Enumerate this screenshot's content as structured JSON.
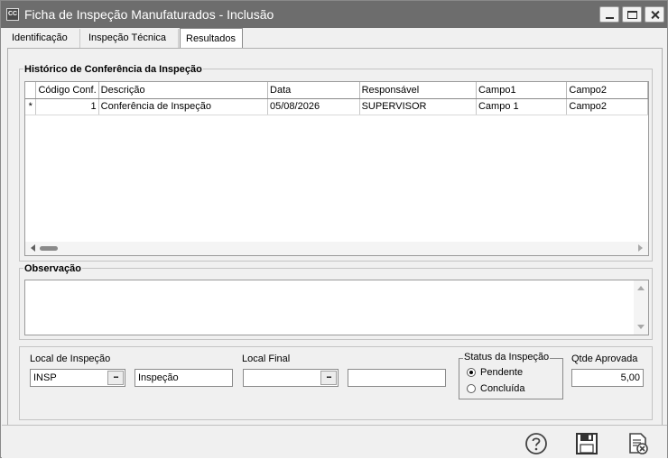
{
  "window": {
    "app_icon_text": "CC",
    "title": "Ficha de Inspeção Manufaturados - Inclusão"
  },
  "tabs": [
    {
      "label": "Identificação",
      "active": false
    },
    {
      "label": "Inspeção Técnica",
      "active": false
    },
    {
      "label": "Resultados",
      "active": true
    }
  ],
  "historico": {
    "title": "Histórico de Conferência da Inspeção",
    "columns": [
      "Código Conf.",
      "Descrição",
      "Data",
      "Responsável",
      "Campo1",
      "Campo2"
    ],
    "rows": [
      {
        "indicator": "*",
        "codigo": "1",
        "descricao": "Conferência de Inspeção",
        "data": "05/08/2026",
        "responsavel": "SUPERVISOR",
        "campo1": "Campo 1",
        "campo2": "Campo2"
      }
    ]
  },
  "observacao": {
    "title": "Observação",
    "value": ""
  },
  "local_inspecao": {
    "label": "Local de Inspeção",
    "code": "INSP",
    "lookup_label": "...",
    "description": "Inspeção"
  },
  "local_final": {
    "label": "Local Final",
    "code": "",
    "lookup_label": "...",
    "description": ""
  },
  "status": {
    "title": "Status da Inspeção",
    "options": [
      {
        "label": "Pendente",
        "checked": true
      },
      {
        "label": "Concluída",
        "checked": false
      }
    ]
  },
  "qtde_aprovada": {
    "label": "Qtde Aprovada",
    "value": "5,00"
  },
  "footer": {
    "buttons": [
      "help-icon",
      "save-icon",
      "cancel-document-icon"
    ]
  }
}
